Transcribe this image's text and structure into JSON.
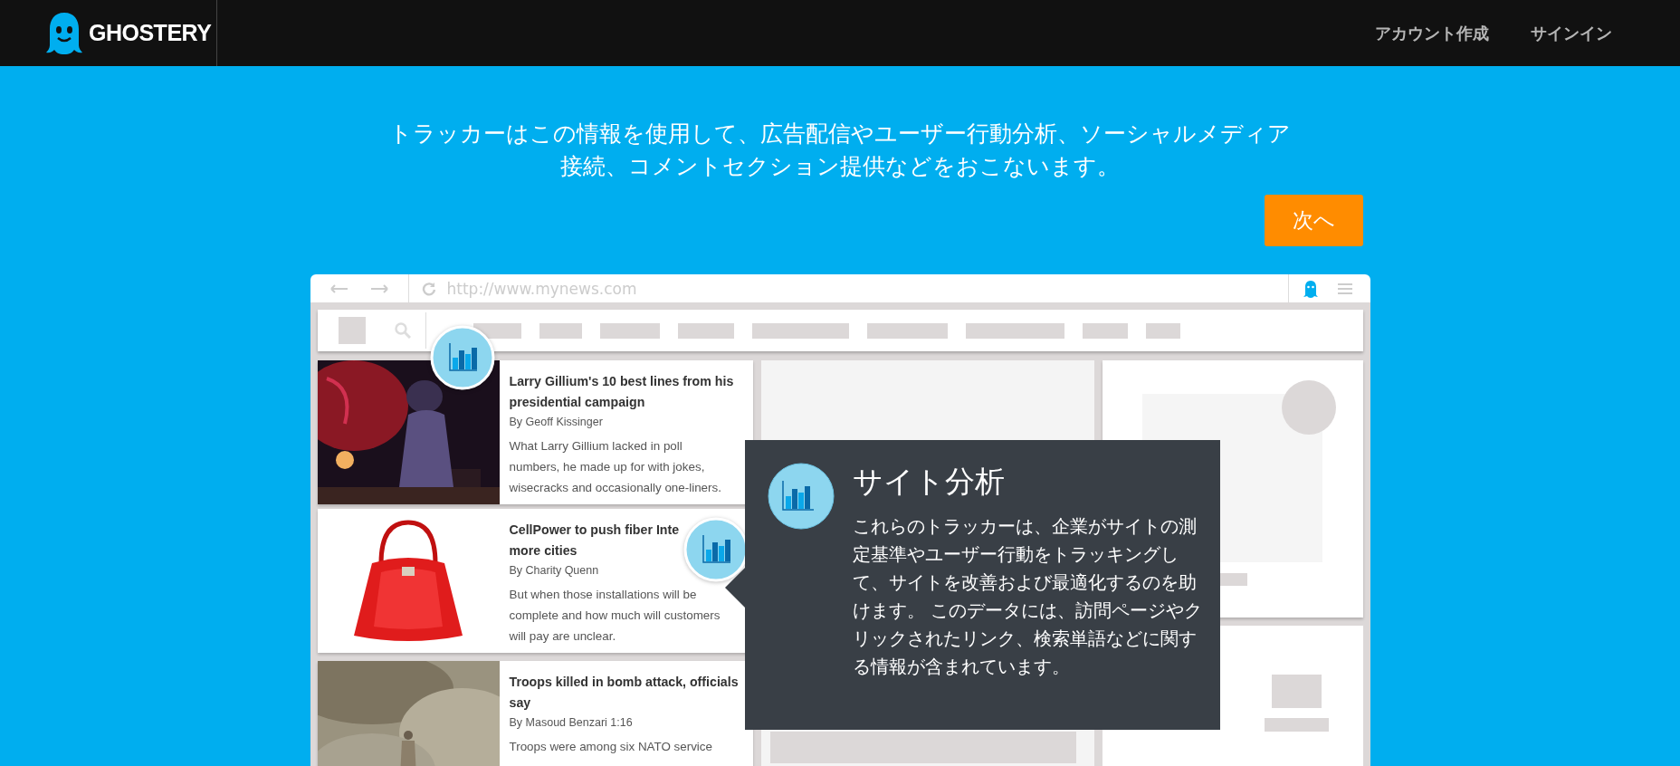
{
  "header": {
    "logo": "GHOSTERY",
    "links": [
      "アカウント作成",
      "サインイン"
    ]
  },
  "intro": "トラッカーはこの情報を使用して、広告配信やユーザー行動分析、ソーシャルメディア接続、コメントセクション提供などをおこないます。",
  "next_button": "次へ",
  "browser": {
    "url": "http://www.mynews.com"
  },
  "articles": [
    {
      "kind": "concert",
      "title_lines": [
        "Larry Gillium's 10 best lines from his",
        "presidential campaign"
      ],
      "byline": "By Geoff Kissinger",
      "summary": "What Larry Gillium lacked in poll numbers, he made up for with jokes, wisecracks and occasionally one-liners."
    },
    {
      "kind": "handbag",
      "title_lines": [
        "CellPower to push fiber Inte",
        "more cities"
      ],
      "byline": "By Charity Quenn",
      "summary": "But when those installations will be complete and how much will customers will pay are unclear."
    },
    {
      "kind": "smoke",
      "title_lines": [
        "Troops killed in bomb attack, officials",
        "say"
      ],
      "byline": "By Masoud Benzari 1:16",
      "summary": "Troops were among six NATO service"
    }
  ],
  "tooltip": {
    "title": "サイト分析",
    "body": "これらのトラッカーは、企業がサイトの測定基準やユーザー行動をトラッキングして、サイトを改善および最適化するのを助けます。 このデータには、訪問ページやクリックされたリンク、検索単語などに関する情報が含まれています。"
  }
}
